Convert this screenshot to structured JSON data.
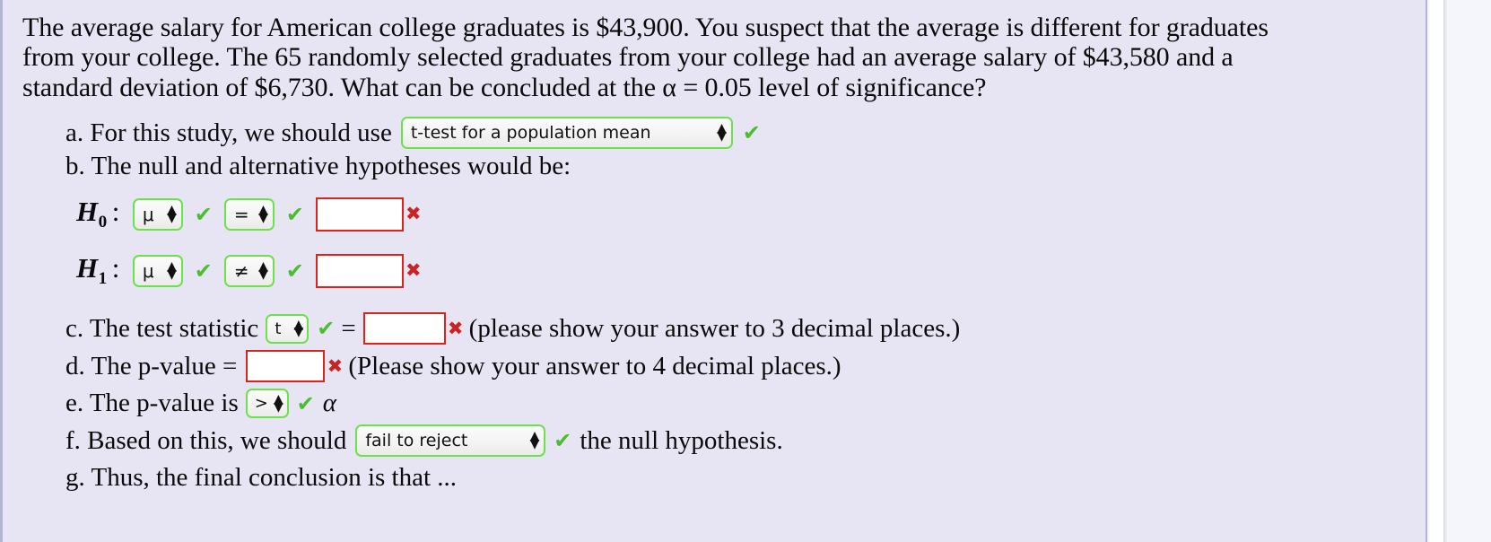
{
  "problem": {
    "text": "The average salary for American college graduates is $43,900. You suspect that the average is different for graduates from your college. The 65 randomly selected graduates from your college had an average salary of $43,580 and a standard deviation of $6,730. What can be concluded at the  α = 0.05 level of significance?",
    "population_mean": "$43,900",
    "sample_size": "65",
    "sample_mean": "$43,580",
    "sample_sd": "$6,730",
    "alpha": "0.05"
  },
  "steps": {
    "a": {
      "label": "a. For this study, we should use",
      "test_select_value": "t-test for a population mean",
      "status": "correct"
    },
    "b": {
      "label": "b. The null and alternative hypotheses would be:",
      "null": {
        "name": "H",
        "subscript": "0",
        "colon": ":",
        "parameter": "μ",
        "operator": "=",
        "value": "",
        "value_placeholder": "",
        "param_status": "correct",
        "operator_status": "correct",
        "value_status": "incorrect"
      },
      "alt": {
        "name": "H",
        "subscript": "1",
        "colon": ":",
        "parameter": "μ",
        "operator": "≠",
        "value": "",
        "value_placeholder": "",
        "param_status": "correct",
        "operator_status": "correct",
        "value_status": "incorrect"
      }
    },
    "c": {
      "label_before": "c. The test statistic",
      "statistic_select_value": "t",
      "statistic_status": "correct",
      "equals": "=",
      "value": "",
      "value_status": "incorrect",
      "label_after": "(please show your answer to 3 decimal places.)"
    },
    "d": {
      "label_before": "d. The p-value =",
      "value": "",
      "value_status": "incorrect",
      "label_after": "(Please show your answer to 4 decimal places.)"
    },
    "e": {
      "label_before": "e. The p-value is",
      "comparison_select_value": ">",
      "comparison_status": "correct",
      "label_after": "α"
    },
    "f": {
      "label_before": "f. Based on this, we should",
      "decision_select_value": "fail to reject",
      "decision_status": "correct",
      "label_after": "the null hypothesis."
    },
    "g": {
      "label": "g. Thus, the final conclusion is that ..."
    }
  },
  "icons": {
    "check": "✔",
    "cross": "✖",
    "spinner_up": "▲",
    "spinner_down": "▼"
  },
  "colors": {
    "panel_background": "#e7e5f3",
    "select_border_valid": "#6ce24a",
    "input_border_invalid": "#e32119",
    "check_green": "#4bbd2e",
    "cross_red": "#cc2222",
    "text": "#0a0a0a"
  }
}
